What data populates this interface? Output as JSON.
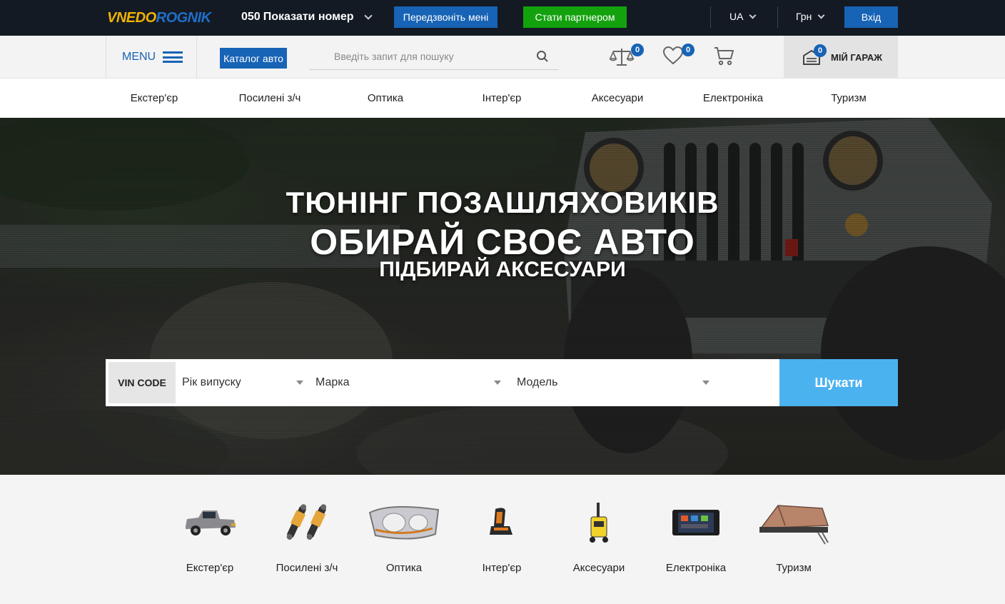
{
  "topbar": {
    "logo_part1": "VNEDO",
    "logo_part2": "ROGNIK",
    "phone_code": "050",
    "phone_action": "Показати номер",
    "callback_button": "Передзвоніть мені",
    "partner_button": "Стати партнером",
    "language": "UA",
    "currency": "Грн",
    "login_button": "Вхід"
  },
  "header": {
    "menu_label": "MENU",
    "catalog_button": "Каталог авто",
    "search_placeholder": "Введіть запит для пошуку",
    "compare_count": "0",
    "wishlist_count": "0",
    "garage_count": "0",
    "garage_label": "МІЙ ГАРАЖ"
  },
  "nav": {
    "items": [
      "Екстер'єр",
      "Посилені з/ч",
      "Оптика",
      "Інтер'єр",
      "Аксесуари",
      "Електроніка",
      "Туризм"
    ]
  },
  "hero": {
    "line1": "ТЮНІНГ ПОЗАШЛЯХОВИКІВ",
    "line2": "ОБИРАЙ СВОЄ АВТО",
    "line3": "ПІДБИРАЙ АКСЕСУАРИ"
  },
  "finder": {
    "vin_label": "VIN CODE",
    "year_select": "Рік випуску",
    "brand_select": "Марка",
    "model_select": "Модель",
    "search_button": "Шукати"
  },
  "categories": [
    {
      "label": "Екстер'єр",
      "icon": "pickup-truck-icon"
    },
    {
      "label": "Посилені з/ч",
      "icon": "shock-absorbers-icon"
    },
    {
      "label": "Оптика",
      "icon": "headlight-icon"
    },
    {
      "label": "Інтер'єр",
      "icon": "car-seat-icon"
    },
    {
      "label": "Аксесуари",
      "icon": "pressure-washer-icon"
    },
    {
      "label": "Електроніка",
      "icon": "head-unit-icon"
    },
    {
      "label": "Туризм",
      "icon": "roof-tent-icon"
    }
  ],
  "colors": {
    "topbar_bg": "#141a24",
    "brand_blue": "#1763b6",
    "partner_green": "#13a20e",
    "search_button": "#4bb2f0",
    "logo_yellow": "#f0b400"
  }
}
